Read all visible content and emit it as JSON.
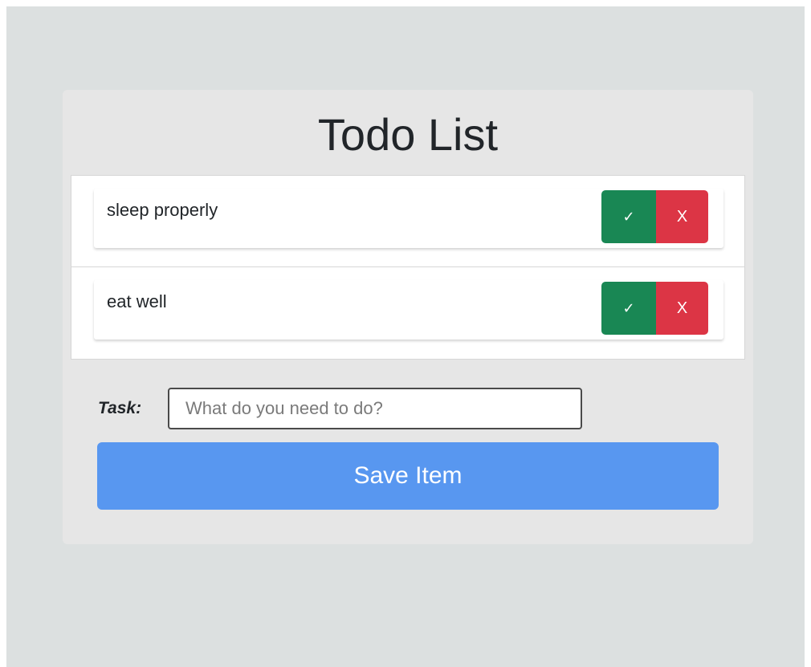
{
  "app": {
    "title": "Todo List"
  },
  "todos": [
    {
      "text": "sleep properly",
      "done_label": "✓",
      "delete_label": "X"
    },
    {
      "text": "eat well",
      "done_label": "✓",
      "delete_label": "X"
    }
  ],
  "form": {
    "task_label": "Task:",
    "task_placeholder": "What do you need to do?",
    "task_value": "",
    "save_label": "Save Item"
  },
  "colors": {
    "page_background": "#dce0e0",
    "card_background": "#e6e6e6",
    "done_button": "#198754",
    "delete_button": "#dc3545",
    "save_button": "#5897f0"
  },
  "icons": {
    "done": "check-icon",
    "delete": "x-icon"
  }
}
